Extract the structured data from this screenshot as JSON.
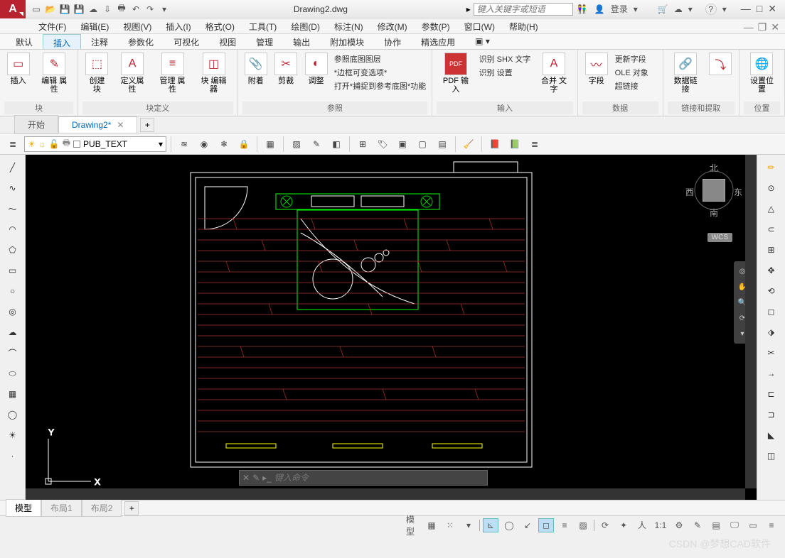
{
  "app": {
    "title": "Drawing2.dwg",
    "search_placeholder": "键入关键字或短语",
    "login": "登录"
  },
  "menubar": [
    "文件(F)",
    "编辑(E)",
    "视图(V)",
    "插入(I)",
    "格式(O)",
    "工具(T)",
    "绘图(D)",
    "标注(N)",
    "修改(M)",
    "参数(P)",
    "窗口(W)",
    "帮助(H)"
  ],
  "ribbon_tabs": [
    "默认",
    "插入",
    "注释",
    "参数化",
    "可视化",
    "视图",
    "管理",
    "输出",
    "附加模块",
    "协作",
    "精选应用"
  ],
  "ribbon_active": 1,
  "ribbon": {
    "block": {
      "label": "块",
      "buttons": [
        {
          "t": "插入"
        },
        {
          "t": "编辑\n属性"
        }
      ]
    },
    "blockdef": {
      "label": "块定义",
      "buttons": [
        {
          "t": "创建块"
        },
        {
          "t": "定义属性"
        },
        {
          "t": "管理\n属性"
        },
        {
          "t": "块\n编辑器"
        }
      ]
    },
    "ref": {
      "label": "参照",
      "buttons": [
        {
          "t": "附着"
        },
        {
          "t": "剪裁"
        },
        {
          "t": "调整"
        }
      ],
      "list": [
        "参照底图图层",
        "*边框可变选项*",
        "打开*捕捉到参考底图*功能"
      ]
    },
    "import": {
      "label": "输入",
      "pdf": "PDF\n输入",
      "list": [
        "识别 SHX 文字",
        "识别 设置"
      ],
      "merge": "合并\n文字"
    },
    "data": {
      "label": "数据",
      "field": "字段",
      "list": [
        "更新字段",
        "OLE 对象",
        "超链接"
      ]
    },
    "link": {
      "label": "链接和提取",
      "btn": "数据链接"
    },
    "loc": {
      "label": "位置",
      "btn": "设置位置"
    }
  },
  "doctabs": [
    {
      "label": "开始",
      "active": false
    },
    {
      "label": "Drawing2*",
      "active": true
    }
  ],
  "layer": {
    "name": "PUB_TEXT"
  },
  "modeltabs": [
    "模型",
    "布局1",
    "布局2"
  ],
  "viewcube": {
    "n": "北",
    "s": "南",
    "e": "东",
    "w": "西"
  },
  "wcs": "WCS",
  "cmd_placeholder": "键入命令",
  "status": {
    "model": "模型",
    "scale": "1:1"
  },
  "watermark": "CSDN @梦想CAD软件"
}
